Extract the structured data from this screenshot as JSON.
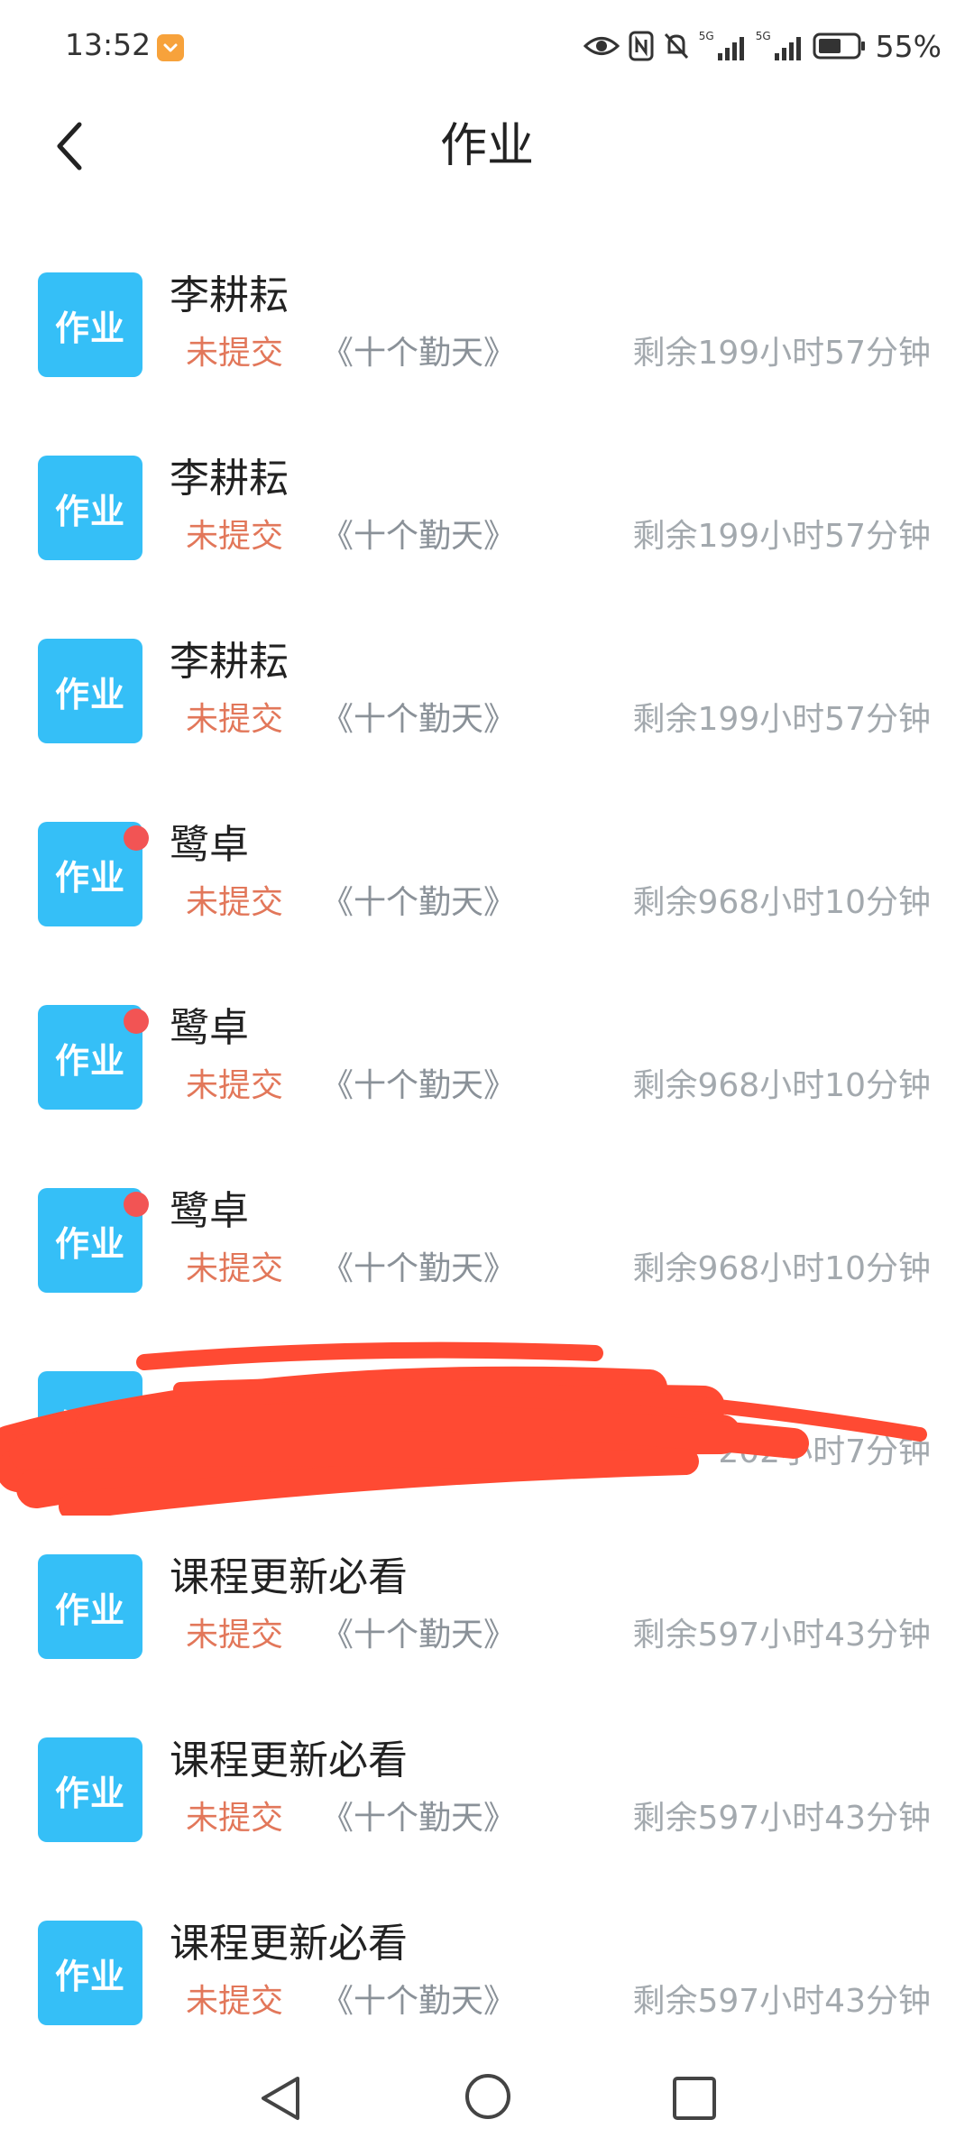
{
  "status_bar": {
    "time": "13:52",
    "battery_percent": "55%",
    "network_1": "5G",
    "network_2": "5G"
  },
  "header": {
    "title": "作业"
  },
  "items": [
    {
      "badge": "作业",
      "title": "李耕耘",
      "status": "未提交",
      "course": "《十个勤天》",
      "remaining": "剩余199小时57分钟",
      "unread": false
    },
    {
      "badge": "作业",
      "title": "李耕耘",
      "status": "未提交",
      "course": "《十个勤天》",
      "remaining": "剩余199小时57分钟",
      "unread": false
    },
    {
      "badge": "作业",
      "title": "李耕耘",
      "status": "未提交",
      "course": "《十个勤天》",
      "remaining": "剩余199小时57分钟",
      "unread": false
    },
    {
      "badge": "作业",
      "title": "鹭卓",
      "status": "未提交",
      "course": "《十个勤天》",
      "remaining": "剩余968小时10分钟",
      "unread": true
    },
    {
      "badge": "作业",
      "title": "鹭卓",
      "status": "未提交",
      "course": "《十个勤天》",
      "remaining": "剩余968小时10分钟",
      "unread": true
    },
    {
      "badge": "作业",
      "title": "鹭卓",
      "status": "未提交",
      "course": "《十个勤天》",
      "remaining": "剩余968小时10分钟",
      "unread": true
    },
    {
      "badge": "作业",
      "title": "",
      "status": "",
      "course": "",
      "remaining": "202小时7分钟",
      "unread": false
    },
    {
      "badge": "作业",
      "title": "课程更新必看",
      "status": "未提交",
      "course": "《十个勤天》",
      "remaining": "剩余597小时43分钟",
      "unread": false
    },
    {
      "badge": "作业",
      "title": "课程更新必看",
      "status": "未提交",
      "course": "《十个勤天》",
      "remaining": "剩余597小时43分钟",
      "unread": false
    },
    {
      "badge": "作业",
      "title": "课程更新必看",
      "status": "未提交",
      "course": "《十个勤天》",
      "remaining": "剩余597小时43分钟",
      "unread": false
    }
  ],
  "colors": {
    "badge": "#35bff7",
    "status_red": "#e2775a",
    "unread_dot": "#f25454",
    "scribble": "#ff4a33"
  }
}
